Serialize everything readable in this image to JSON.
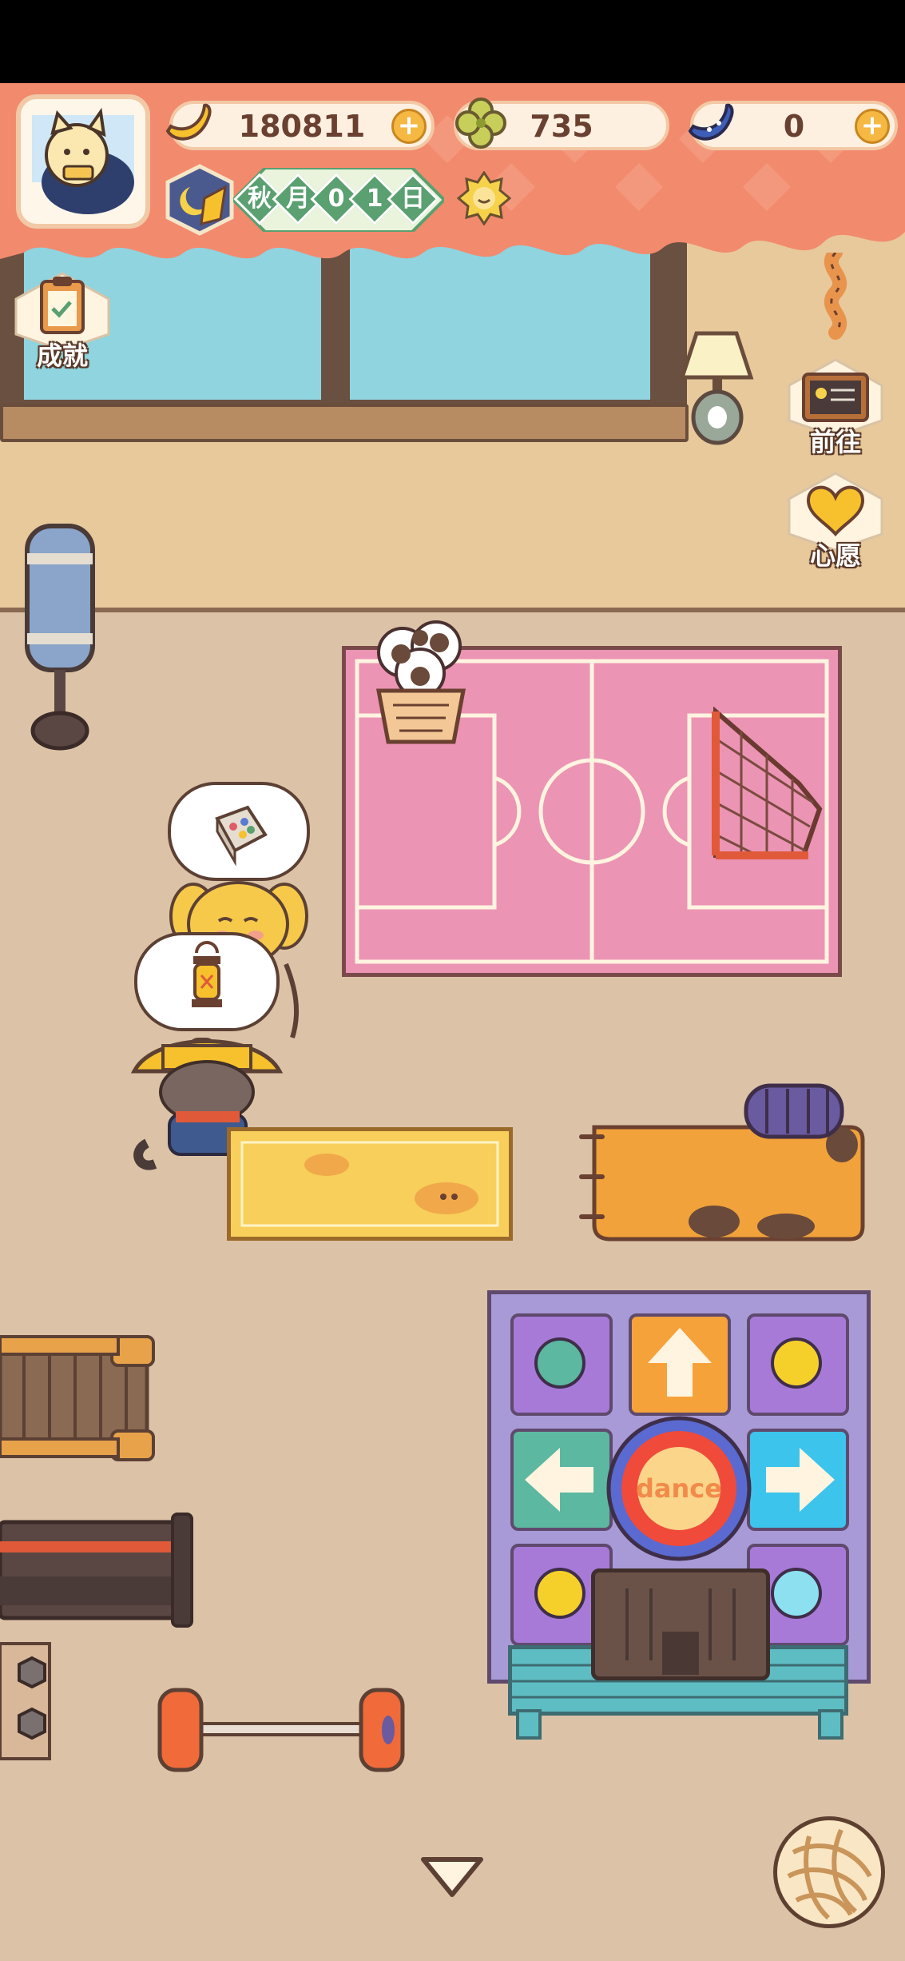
{
  "hud": {
    "bananas": "180811",
    "clovers": "735",
    "blue_bananas": "0",
    "plus_label": "+"
  },
  "date": {
    "season": "秋",
    "unit_month": "月",
    "day_tens": "0",
    "day_ones": "1",
    "unit_day": "日",
    "weather": "sunny-icon"
  },
  "side_buttons": {
    "achievements": "成就",
    "goto": "前往",
    "wishes": "心愿"
  },
  "scene": {
    "dance_pad_label": "dance"
  },
  "colors": {
    "banner": "#f28a6e",
    "wall": "#e8c99b",
    "floor": "#dcc3a7",
    "court": "#ec94b4",
    "dance_pad": "#a89ad6"
  }
}
